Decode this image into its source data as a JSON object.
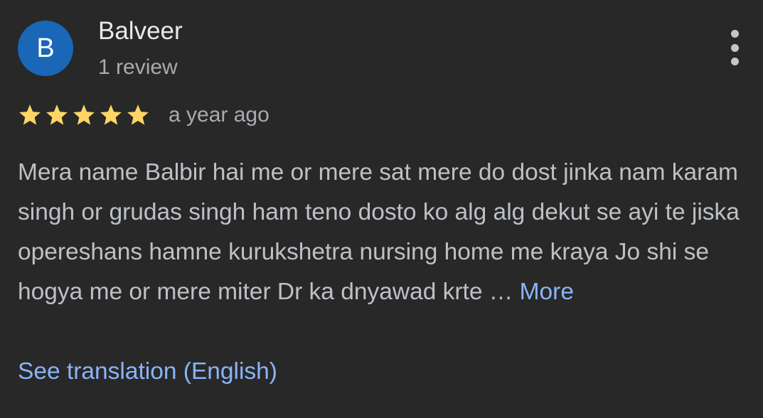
{
  "review": {
    "author": {
      "initial": "B",
      "name": "Balveer",
      "review_count": "1 review",
      "avatar_color": "#1967b6"
    },
    "menu_icon": "more-vert-icon",
    "rating": {
      "stars": 5,
      "max": 5,
      "star_color": "#fdd663"
    },
    "date": "a year ago",
    "text": "Mera name Balbir hai me or mere sat mere do dost jinka nam karam singh or grudas singh ham teno dosto ko alg alg dekut se ayi te jiska opereshans hamne kurukshetra nursing home me kraya Jo shi se hogya me or mere miter Dr ka dnyawad krte …",
    "more_label": "More",
    "translate_label": "See translation (English)",
    "link_color": "#8ab4f8"
  }
}
